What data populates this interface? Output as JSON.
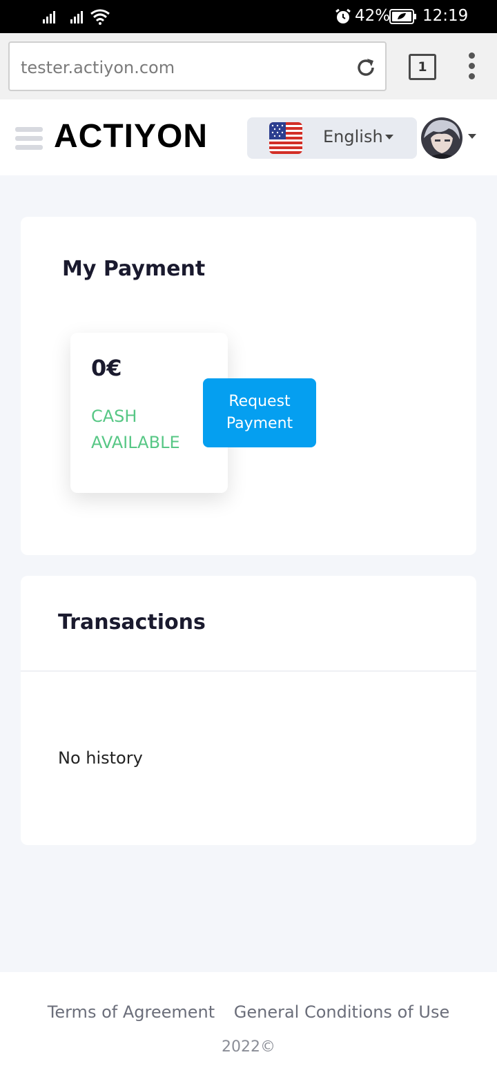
{
  "status_bar": {
    "battery_percent": "42%",
    "time": "12:19"
  },
  "browser": {
    "url": "tester.actiyon.com",
    "tab_count": "1"
  },
  "header": {
    "logo_text": "ACTIYON",
    "language": "English",
    "flag_icon": "us-flag-icon"
  },
  "payment": {
    "title": "My Payment",
    "amount": "0€",
    "cash_label": "CASH AVAILABLE",
    "request_button": "Request Payment",
    "accent_color": "#57c785",
    "button_color": "#059ff0"
  },
  "transactions": {
    "title": "Transactions",
    "empty_text": "No history"
  },
  "footer": {
    "terms_link": "Terms of Agreement",
    "conditions_link": "General Conditions of Use",
    "copyright": "2022©"
  }
}
